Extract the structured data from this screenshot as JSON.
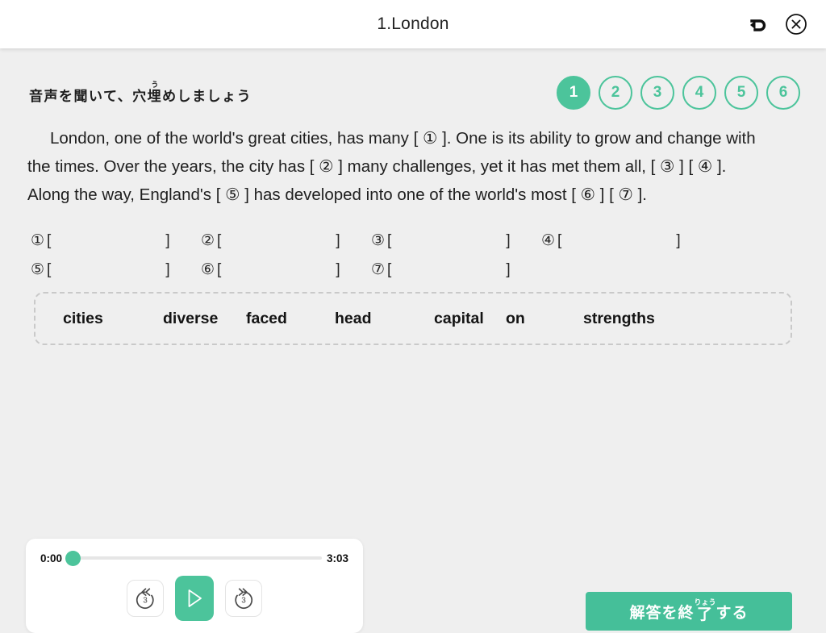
{
  "header": {
    "title": "1.London",
    "undo_icon": "undo-arrow-icon",
    "close_icon": "close-circle-icon"
  },
  "prompt": {
    "heading_pre": "音声を聞いて、穴",
    "heading_ruby_base": "埋",
    "heading_ruby_text": "う",
    "heading_post": "めしましょう"
  },
  "pager": {
    "items": [
      {
        "label": "1",
        "active": true
      },
      {
        "label": "2",
        "active": false
      },
      {
        "label": "3",
        "active": false
      },
      {
        "label": "4",
        "active": false
      },
      {
        "label": "5",
        "active": false
      },
      {
        "label": "6",
        "active": false
      }
    ]
  },
  "passage": {
    "text": "London, one of the world's great cities, has many [ ① ].  One is its ability to grow and change with the times. Over the years, the city has [ ② ] many challenges, yet it has met them all, [ ③ ] [ ④ ]. Along the way, England's [ ⑤ ] has developed into one of the world's most [ ⑥ ] [ ⑦ ]."
  },
  "answers": {
    "rows": [
      [
        {
          "num": "①",
          "open": "[",
          "value": "",
          "close": "]"
        },
        {
          "num": "②",
          "open": "[",
          "value": "",
          "close": "]"
        },
        {
          "num": "③",
          "open": "[",
          "value": "",
          "close": "]"
        },
        {
          "num": "④",
          "open": "[",
          "value": "",
          "close": "]"
        }
      ],
      [
        {
          "num": "⑤",
          "open": "[",
          "value": "",
          "close": "]"
        },
        {
          "num": "⑥",
          "open": "[",
          "value": "",
          "close": "]"
        },
        {
          "num": "⑦",
          "open": "[",
          "value": "",
          "close": "]"
        }
      ]
    ]
  },
  "wordbank": {
    "words": [
      "cities",
      "diverse",
      "faced",
      "head",
      "capital",
      "on",
      "strengths"
    ]
  },
  "player": {
    "current_time": "0:00",
    "duration": "3:03",
    "progress_percent": 0,
    "rewind_icon": "rewind-3-seconds-icon",
    "rewind_label": "3",
    "play_icon": "play-icon",
    "forward_icon": "forward-3-seconds-icon",
    "forward_label": "3"
  },
  "submit": {
    "label_pre": "解答を終",
    "label_ruby_base": "了",
    "label_ruby_text": "りょう",
    "label_post": "する"
  },
  "colors": {
    "accent": "#4cc49b",
    "accent_button": "#45bf99",
    "page_background": "#efefef",
    "header_background": "#ffffff",
    "text": "#1f1f1f",
    "dashed_border": "#c9c9c9"
  }
}
